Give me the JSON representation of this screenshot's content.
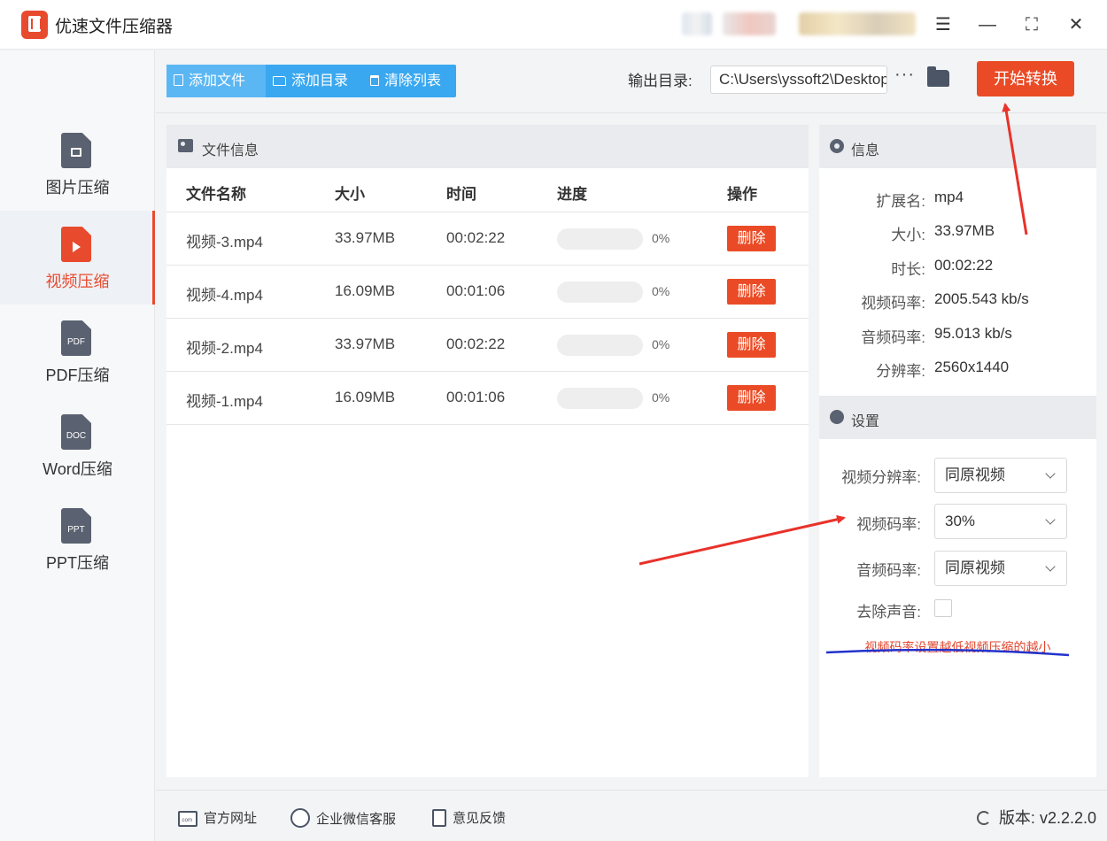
{
  "app": {
    "title": "优速文件压缩器"
  },
  "window_controls": {
    "menu": "☰",
    "minimize": "—",
    "maximize": "⛶",
    "close": "✕"
  },
  "sidebar": {
    "items": [
      {
        "label": "图片压缩",
        "icon": "image-file-icon",
        "glyph": ""
      },
      {
        "label": "视频压缩",
        "icon": "video-file-icon",
        "glyph": ""
      },
      {
        "label": "PDF压缩",
        "icon": "pdf-file-icon",
        "glyph": "PDF"
      },
      {
        "label": "Word压缩",
        "icon": "doc-file-icon",
        "glyph": "DOC"
      },
      {
        "label": "PPT压缩",
        "icon": "ppt-file-icon",
        "glyph": "PPT"
      }
    ],
    "active_index": 1
  },
  "toolbar": {
    "add_file": "添加文件",
    "add_folder": "添加目录",
    "clear_list": "清除列表",
    "output_label": "输出目录:",
    "output_path": "C:\\Users\\yssoft2\\Desktop",
    "more": "···",
    "start": "开始转换"
  },
  "file_panel": {
    "title": "文件信息",
    "columns": [
      "文件名称",
      "大小",
      "时间",
      "进度",
      "操作"
    ],
    "rows": [
      {
        "name": "视频-3.mp4",
        "size": "33.97MB",
        "time": "00:02:22",
        "progress": 0,
        "progress_text": "0%",
        "action": "删除"
      },
      {
        "name": "视频-4.mp4",
        "size": "16.09MB",
        "time": "00:01:06",
        "progress": 0,
        "progress_text": "0%",
        "action": "删除"
      },
      {
        "name": "视频-2.mp4",
        "size": "33.97MB",
        "time": "00:02:22",
        "progress": 0,
        "progress_text": "0%",
        "action": "删除"
      },
      {
        "name": "视频-1.mp4",
        "size": "16.09MB",
        "time": "00:01:06",
        "progress": 0,
        "progress_text": "0%",
        "action": "删除"
      }
    ]
  },
  "info": {
    "title": "信息",
    "fields": [
      {
        "key": "扩展名:",
        "value": "mp4"
      },
      {
        "key": "大小:",
        "value": "33.97MB"
      },
      {
        "key": "时长:",
        "value": "00:02:22"
      },
      {
        "key": "视频码率:",
        "value": "2005.543 kb/s"
      },
      {
        "key": "音频码率:",
        "value": "95.013 kb/s"
      },
      {
        "key": "分辨率:",
        "value": "2560x1440"
      }
    ]
  },
  "settings": {
    "title": "设置",
    "video_resolution_label": "视频分辨率:",
    "video_resolution_value": "同原视频",
    "video_bitrate_label": "视频码率:",
    "video_bitrate_value": "30%",
    "audio_bitrate_label": "音频码率:",
    "audio_bitrate_value": "同原视频",
    "remove_audio_label": "去除声音:",
    "remove_audio_checked": false,
    "tip": "视频码率设置越低视频压缩的越小"
  },
  "footer": {
    "website": "官方网址",
    "wechat_support": "企业微信客服",
    "feedback": "意见反馈",
    "version": "版本:  v2.2.2.0"
  },
  "colors": {
    "accent": "#ea4b26",
    "toolbar_blue": "#3aa8f0",
    "annotation_red": "#e8322a"
  }
}
